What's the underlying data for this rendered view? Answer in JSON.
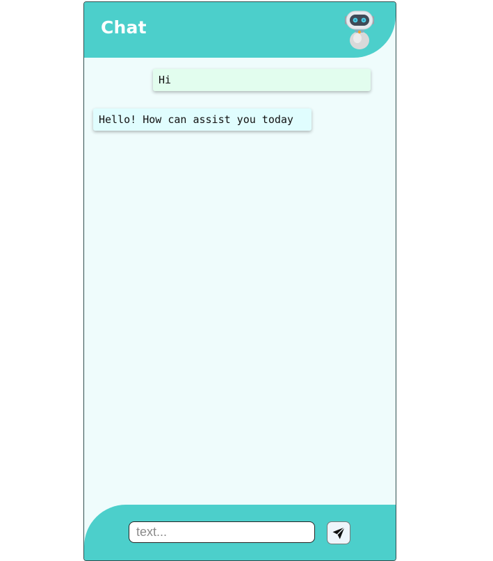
{
  "header": {
    "title": "Chat",
    "avatar_icon": "robot-icon"
  },
  "messages": [
    {
      "sender": "user",
      "text": "Hi"
    },
    {
      "sender": "bot",
      "text": "Hello! How can assist you today"
    }
  ],
  "composer": {
    "placeholder": "text...",
    "value": "",
    "send_icon": "paper-plane-icon"
  },
  "colors": {
    "accent": "#4ccfcb",
    "background": "#effcfc",
    "user_bubble": "#e2fdee",
    "bot_bubble": "#e0fdfe"
  }
}
